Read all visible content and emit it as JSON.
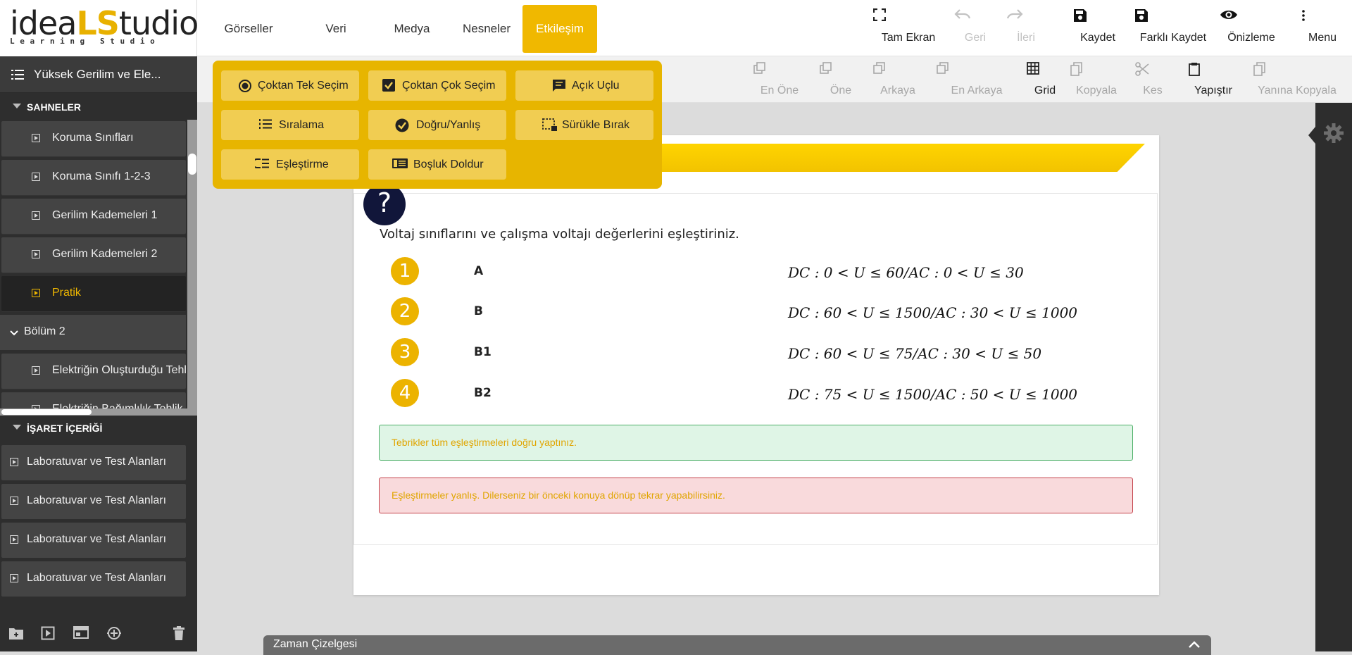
{
  "logo": {
    "ideal": "idea",
    "ls": "LS",
    "studio": "tudio",
    "tagline": "Learning Studio"
  },
  "project": {
    "title": "Yüksek Gerilim ve Ele..."
  },
  "sidebar": {
    "scenes_header": "SAHNELER",
    "scenes": [
      {
        "label": "Koruma Sınıfları"
      },
      {
        "label": "Koruma Sınıfı 1-2-3"
      },
      {
        "label": "Gerilim Kademeleri 1"
      },
      {
        "label": "Gerilim Kademeleri 2"
      },
      {
        "label": "Pratik"
      }
    ],
    "section2": "Bölüm 2",
    "section2_items": [
      {
        "label": "Elektriğin Oluşturduğu Tehlik"
      },
      {
        "label": "Elektriğin Bağımlılık Tehlik"
      }
    ],
    "signs_header": "İŞARET İÇERİĞİ",
    "signs": [
      {
        "label": "Laboratuvar ve Test Alanları"
      },
      {
        "label": "Laboratuvar ve Test Alanları"
      },
      {
        "label": "Laboratuvar ve Test Alanları"
      },
      {
        "label": "Laboratuvar ve Test Alanları"
      }
    ]
  },
  "menu_tabs": [
    {
      "label": "Görseller"
    },
    {
      "label": "Veri"
    },
    {
      "label": "Medya"
    },
    {
      "label": "Nesneler"
    },
    {
      "label": "Etkileşim"
    }
  ],
  "top_actions": [
    {
      "label": "Tam Ekran",
      "icon": "fullscreen-icon"
    },
    {
      "label": "Geri",
      "icon": "undo-icon"
    },
    {
      "label": "İleri",
      "icon": "redo-icon"
    },
    {
      "label": "Kaydet",
      "icon": "save-icon"
    },
    {
      "label": "Farklı Kaydet",
      "icon": "save-as-icon"
    },
    {
      "label": "Önizleme",
      "icon": "eye-icon"
    },
    {
      "label": "Menu",
      "icon": "more-vertical-icon"
    }
  ],
  "toolbar2": [
    {
      "label": "En Öne"
    },
    {
      "label": "Öne"
    },
    {
      "label": "Arkaya"
    },
    {
      "label": "En Arkaya"
    },
    {
      "label": "Grid"
    },
    {
      "label": "Kopyala"
    },
    {
      "label": "Kes"
    },
    {
      "label": "Yapıştır"
    },
    {
      "label": "Yanına Kopyala"
    }
  ],
  "interaction_menu": [
    {
      "label": "Çoktan Tek Seçim",
      "icon": "radio-icon"
    },
    {
      "label": "Çoktan Çok Seçim",
      "icon": "checkbox-icon"
    },
    {
      "label": "Açık Uçlu",
      "icon": "comment-icon"
    },
    {
      "label": "Sıralama",
      "icon": "ordered-list-icon"
    },
    {
      "label": "Doğru/Yanlış",
      "icon": "check-circle-icon"
    },
    {
      "label": "Sürükle Bırak",
      "icon": "drag-select-icon"
    },
    {
      "label": "Eşleştirme",
      "icon": "match-list-icon"
    },
    {
      "label": "Boşluk Doldur",
      "icon": "fill-blank-icon"
    }
  ],
  "question": {
    "badge": "?",
    "text": "Voltaj sınıflarını ve çalışma voltajı değerlerini eşleştiriniz.",
    "rows": [
      {
        "num": "1",
        "label": "A",
        "value": "DC : 0 < U ≤ 60/AC : 0 < U ≤ 30"
      },
      {
        "num": "2",
        "label": "B",
        "value": "DC : 60 < U ≤ 1500/AC : 30 < U ≤ 1000"
      },
      {
        "num": "3",
        "label": "B1",
        "value": "DC : 60 < U ≤ 75/AC : 30 < U ≤ 50"
      },
      {
        "num": "4",
        "label": "B2",
        "value": "DC : 75 < U ≤ 1500/AC : 50 < U ≤ 1000"
      }
    ],
    "success": "Tebrikler tüm eşleştirmeleri doğru yaptınız.",
    "error": "Eşleştirmeler yanlış. Dilerseniz bir önceki konuya dönüp tekrar yapabilirsiniz."
  },
  "timeline": {
    "label": "Zaman Çizelgesi"
  },
  "colors": {
    "accent": "#f0b800",
    "sidebar_bg": "#2e2e2e",
    "number_badge": "#ecb300",
    "question_badge": "#11163a"
  }
}
